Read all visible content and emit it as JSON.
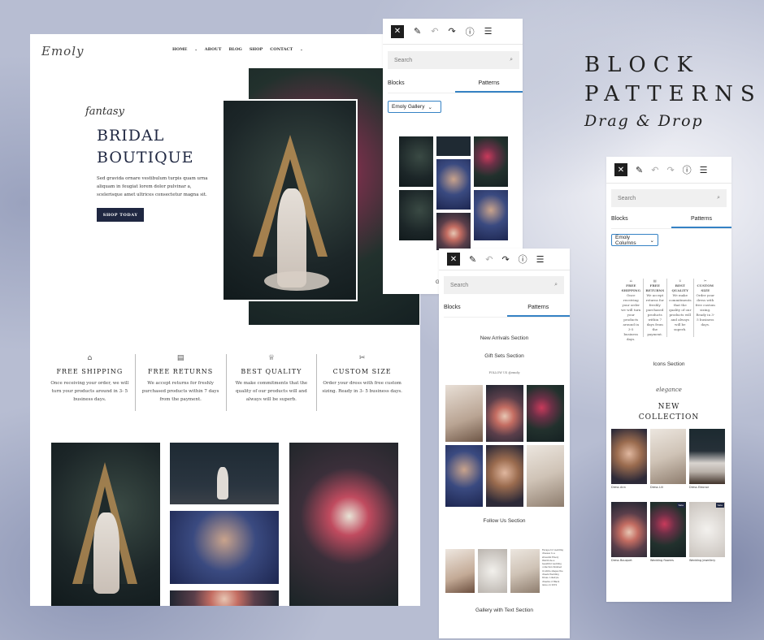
{
  "heading": {
    "line1": "BLOCK",
    "line2": "PATTERNS",
    "line3": "Drag & Drop"
  },
  "site": {
    "logo": "Emoly",
    "nav": [
      "HOME",
      "ABOUT",
      "BLOG",
      "SHOP",
      "CONTACT"
    ],
    "hero": {
      "script": "fantasy",
      "title1": "BRIDAL",
      "title2": "BOUTIQUE",
      "body": "Sed gravida ornare vestibulum turpis quam urna aliquam in feugiat lorem dolor pulvinar a, scelerisque amet ultrices consectetur magna sit.",
      "cta": "SHOP TODAY"
    },
    "features": [
      {
        "icon": "basket-icon",
        "glyph": "⌂",
        "title": "FREE SHIPPING",
        "desc": "Once receiving your order, we will turn your products around in 3- 5 business days."
      },
      {
        "icon": "box-icon",
        "glyph": "▤",
        "title": "FREE RETURNS",
        "desc": "We accept returns for freshly purchased products within 7 days from the payment."
      },
      {
        "icon": "trophy-icon",
        "glyph": "♕",
        "title": "BEST QUALITY",
        "desc": "We make commitments that the quality of our products will and always will be superb."
      },
      {
        "icon": "scissors-icon",
        "glyph": "✂",
        "title": "CUSTOM SIZE",
        "desc": "Order your dress with free custom sizing. Ready in 3- 5 business days."
      }
    ]
  },
  "panel1": {
    "search": "Search",
    "tabs": [
      "Blocks",
      "Patterns"
    ],
    "select": "Emoly Gallery",
    "footer_stub": "G"
  },
  "panel2": {
    "search": "Search",
    "tabs": [
      "Blocks",
      "Patterns"
    ],
    "sections": [
      "New Arrivals Section",
      "Gift Sets Section",
      "Follow Us Section",
      "Gallery with Text Section"
    ],
    "gift_caption": "FOLLOW US @emoly",
    "gallery_text": "Escape for wedding dresses to a stressful Emoly Wardrobe a beautiful wedding collection finished in white shapes the dream Wedding Dress. Lifestyle dreams of Black issue on 2019"
  },
  "panel3": {
    "search": "Search",
    "tabs": [
      "Blocks",
      "Patterns"
    ],
    "select": "Emoly Columns",
    "icons_cols": [
      {
        "t": "FREE SHIPPING",
        "d": "Once receiving your order we will turn your products around in 3-5 business days."
      },
      {
        "t": "FREE RETURNS",
        "d": "We accept returns for freshly purchased products within 7 days from the payment."
      },
      {
        "t": "BEST QUALITY",
        "d": "We make commitments that the quality of our products will and always will be superb."
      },
      {
        "t": "CUSTOM SIZE",
        "d": "Order your dress with free custom sizing. Ready in 3-5 business days."
      }
    ],
    "icons_label": "Icons Section",
    "collection_script": "elegance",
    "collection_title1": "NEW",
    "collection_title2": "COLLECTION",
    "products": [
      "Dress Ann",
      "Dress Lili",
      "Dress Eleonor",
      "Dress Bouquet",
      "Wedding flowers",
      "Wedding Jewellery"
    ],
    "sale": "Sale"
  },
  "toolbar_icons": [
    "close-icon",
    "pencil-icon",
    "undo-icon",
    "redo-icon",
    "info-icon",
    "list-view-icon"
  ],
  "colors": {
    "navy": "#1f2741",
    "accent": "#3582c4",
    "toolbar_dark": "#1e1e1e"
  }
}
